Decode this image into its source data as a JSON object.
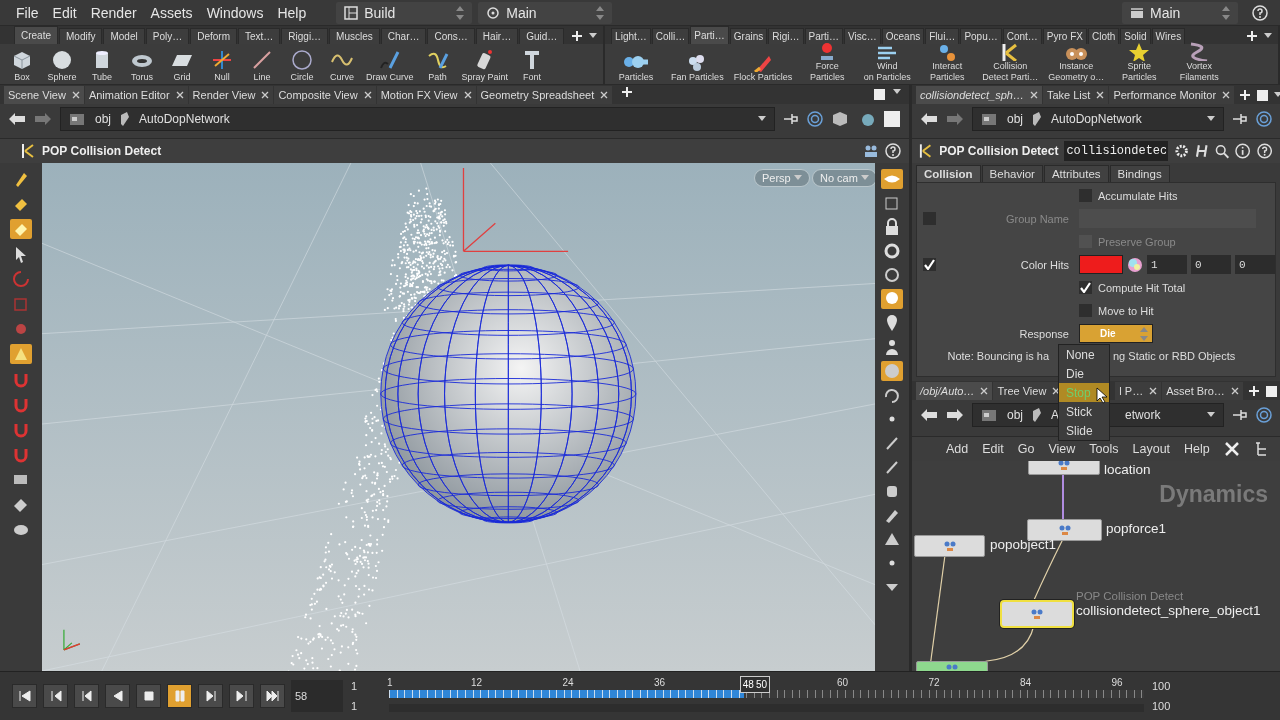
{
  "menubar": {
    "items": [
      "File",
      "Edit",
      "Render",
      "Assets",
      "Windows",
      "Help"
    ],
    "desktop": "Build",
    "layout": "Main",
    "take": "Main"
  },
  "shelf_left": {
    "tabs": [
      {
        "label": "Create",
        "selected": true
      },
      {
        "label": "Modify",
        "selected": false
      },
      {
        "label": "Model",
        "selected": false
      },
      {
        "label": "Poly…",
        "selected": false
      },
      {
        "label": "Deform",
        "selected": false
      },
      {
        "label": "Text…",
        "selected": false
      },
      {
        "label": "Riggi…",
        "selected": false
      },
      {
        "label": "Muscles",
        "selected": false
      },
      {
        "label": "Char…",
        "selected": false
      },
      {
        "label": "Cons…",
        "selected": false
      },
      {
        "label": "Hair…",
        "selected": false
      },
      {
        "label": "Guid…",
        "selected": false
      }
    ],
    "tools": [
      [
        "Box"
      ],
      [
        "Sphere"
      ],
      [
        "Tube"
      ],
      [
        "Torus"
      ],
      [
        "Grid"
      ],
      [
        "Null"
      ],
      [
        "Line"
      ],
      [
        "Circle"
      ],
      [
        "Curve"
      ],
      [
        "Draw Curve"
      ],
      [
        "Path"
      ],
      [
        "Spray Paint"
      ],
      [
        "Font"
      ]
    ]
  },
  "shelf_right": {
    "tabs": [
      {
        "label": "Light…",
        "selected": false
      },
      {
        "label": "Colli…",
        "selected": false
      },
      {
        "label": "Parti…",
        "selected": true
      },
      {
        "label": "Grains",
        "selected": false
      },
      {
        "label": "Rigi…",
        "selected": false
      },
      {
        "label": "Parti…",
        "selected": false
      },
      {
        "label": "Visc…",
        "selected": false
      },
      {
        "label": "Oceans",
        "selected": false
      },
      {
        "label": "Flui…",
        "selected": false
      },
      {
        "label": "Popu…",
        "selected": false
      },
      {
        "label": "Cont…",
        "selected": false
      },
      {
        "label": "Pyro FX",
        "selected": false
      },
      {
        "label": "Cloth",
        "selected": false
      },
      {
        "label": "Solid",
        "selected": false
      },
      {
        "label": "Wires",
        "selected": false
      }
    ],
    "tools": [
      [
        "Particles"
      ],
      [
        "Fan Particles"
      ],
      [
        "Flock Particles"
      ],
      [
        "Force",
        "Particles"
      ],
      [
        "Wind",
        "on Particles"
      ],
      [
        "Interact",
        "Particles"
      ],
      [
        "Collision",
        "Detect Parti…"
      ],
      [
        "Instance",
        "Geometry o…"
      ],
      [
        "Sprite",
        "Particles"
      ],
      [
        "Vortex",
        "Filaments"
      ]
    ]
  },
  "scene_pane": {
    "tabs": [
      {
        "label": "Scene View",
        "selected": true
      },
      {
        "label": "Animation Editor",
        "selected": false
      },
      {
        "label": "Render View",
        "selected": false
      },
      {
        "label": "Composite View",
        "selected": false
      },
      {
        "label": "Motion FX View",
        "selected": false
      },
      {
        "label": "Geometry Spreadsheet",
        "selected": false
      }
    ],
    "path": [
      "obj",
      "AutoDopNetwork"
    ],
    "title": "POP Collision Detect",
    "view_menu": "Persp",
    "camera_menu": "No cam",
    "left_tools": [
      {
        "selected": false
      },
      {
        "selected": false
      },
      {
        "selected": true
      },
      {
        "selected": false
      },
      {
        "selected": false
      },
      {
        "selected": false
      },
      {
        "selected": false
      },
      {
        "selected": true
      },
      {
        "selected": false
      },
      {
        "selected": false
      },
      {
        "selected": false
      },
      {
        "selected": false
      },
      {
        "selected": false
      },
      {
        "selected": false
      },
      {
        "selected": false
      }
    ],
    "right_tools": [
      {
        "selected": true
      },
      {
        "selected": false
      },
      {
        "selected": false
      },
      {
        "selected": false
      },
      {
        "selected": false
      },
      {
        "selected": true
      },
      {
        "selected": false
      },
      {
        "selected": false
      },
      {
        "selected": true
      },
      {
        "selected": false
      },
      {
        "selected": false
      },
      {
        "selected": false
      },
      {
        "selected": false
      },
      {
        "selected": false
      },
      {
        "selected": false
      },
      {
        "selected": false
      },
      {
        "selected": false
      },
      {
        "selected": false
      }
    ]
  },
  "params_pane": {
    "tabs": [
      {
        "label": "collisiondetect_sph…",
        "selected": true
      },
      {
        "label": "Take List",
        "selected": false
      },
      {
        "label": "Performance Monitor",
        "selected": false
      }
    ],
    "path": [
      "obj",
      "AutoDopNetwork"
    ],
    "node_type": "POP Collision Detect",
    "node_name": "collisiondetec",
    "param_tabs": [
      {
        "label": "Collision",
        "selected": true
      },
      {
        "label": "Behavior",
        "selected": false
      },
      {
        "label": "Attributes",
        "selected": false
      },
      {
        "label": "Bindings",
        "selected": false
      }
    ],
    "params": [
      {
        "kind": "toggle",
        "label": "Accumulate Hits",
        "checked": false,
        "disabled": false
      },
      {
        "kind": "field",
        "label": "Group Name",
        "toggle": false,
        "disabled": true
      },
      {
        "kind": "toggle",
        "label": "Preserve Group",
        "checked": false,
        "disabled": true
      },
      {
        "kind": "color",
        "label": "Color Hits",
        "toggle": true,
        "color": "#ee1c1c",
        "values": [
          "1",
          "0",
          "0"
        ]
      },
      {
        "kind": "toggle",
        "label": "Compute Hit Total",
        "checked": true,
        "disabled": false
      },
      {
        "kind": "toggle",
        "label": "Move to Hit",
        "checked": false,
        "disabled": false
      },
      {
        "kind": "menu",
        "label": "Response",
        "value": "Die"
      }
    ],
    "note": [
      "Note: Bouncing is ha",
      "ng Static or RBD Objects"
    ],
    "menu_options": [
      {
        "label": "None",
        "selected": false
      },
      {
        "label": "Die",
        "selected": false
      },
      {
        "label": "Stop",
        "selected": true
      },
      {
        "label": "Stick",
        "selected": false
      },
      {
        "label": "Slide",
        "selected": false
      }
    ]
  },
  "network_pane": {
    "tabs": [
      {
        "label": "/obj/Auto…",
        "selected": true
      },
      {
        "label": "Tree View",
        "selected": false
      },
      {
        "label": "l P…",
        "selected": false
      },
      {
        "label": "Asset Bro…",
        "selected": false
      }
    ],
    "path": [
      "obj",
      "A",
      "etwork"
    ],
    "menus": [
      "Add",
      "Edit",
      "Go",
      "View",
      "Tools",
      "Layout",
      "Help"
    ],
    "context": "Dynamics",
    "nodes": [
      {
        "name": "location",
        "selected": false
      },
      {
        "name": "popforce1",
        "selected": false
      },
      {
        "name": "popobject1",
        "selected": false
      },
      {
        "name": "collisiondetect_sphere_object1",
        "type": "POP Collision Detect",
        "selected": true
      },
      {
        "selected": false
      }
    ]
  },
  "timeline": {
    "buttons": [
      {
        "selected": false
      },
      {
        "selected": false
      },
      {
        "selected": false
      },
      {
        "selected": false
      },
      {
        "selected": false
      },
      {
        "selected": true
      },
      {
        "selected": false
      },
      {
        "selected": false
      },
      {
        "selected": false
      }
    ],
    "frame": "58",
    "start": "1",
    "range_start": "1",
    "end": "100",
    "range_end": "100",
    "ticks": [
      "1",
      "12",
      "24",
      "36",
      "60",
      "72",
      "84",
      "96"
    ],
    "marker": [
      "48",
      "50"
    ],
    "level": 0.47
  }
}
